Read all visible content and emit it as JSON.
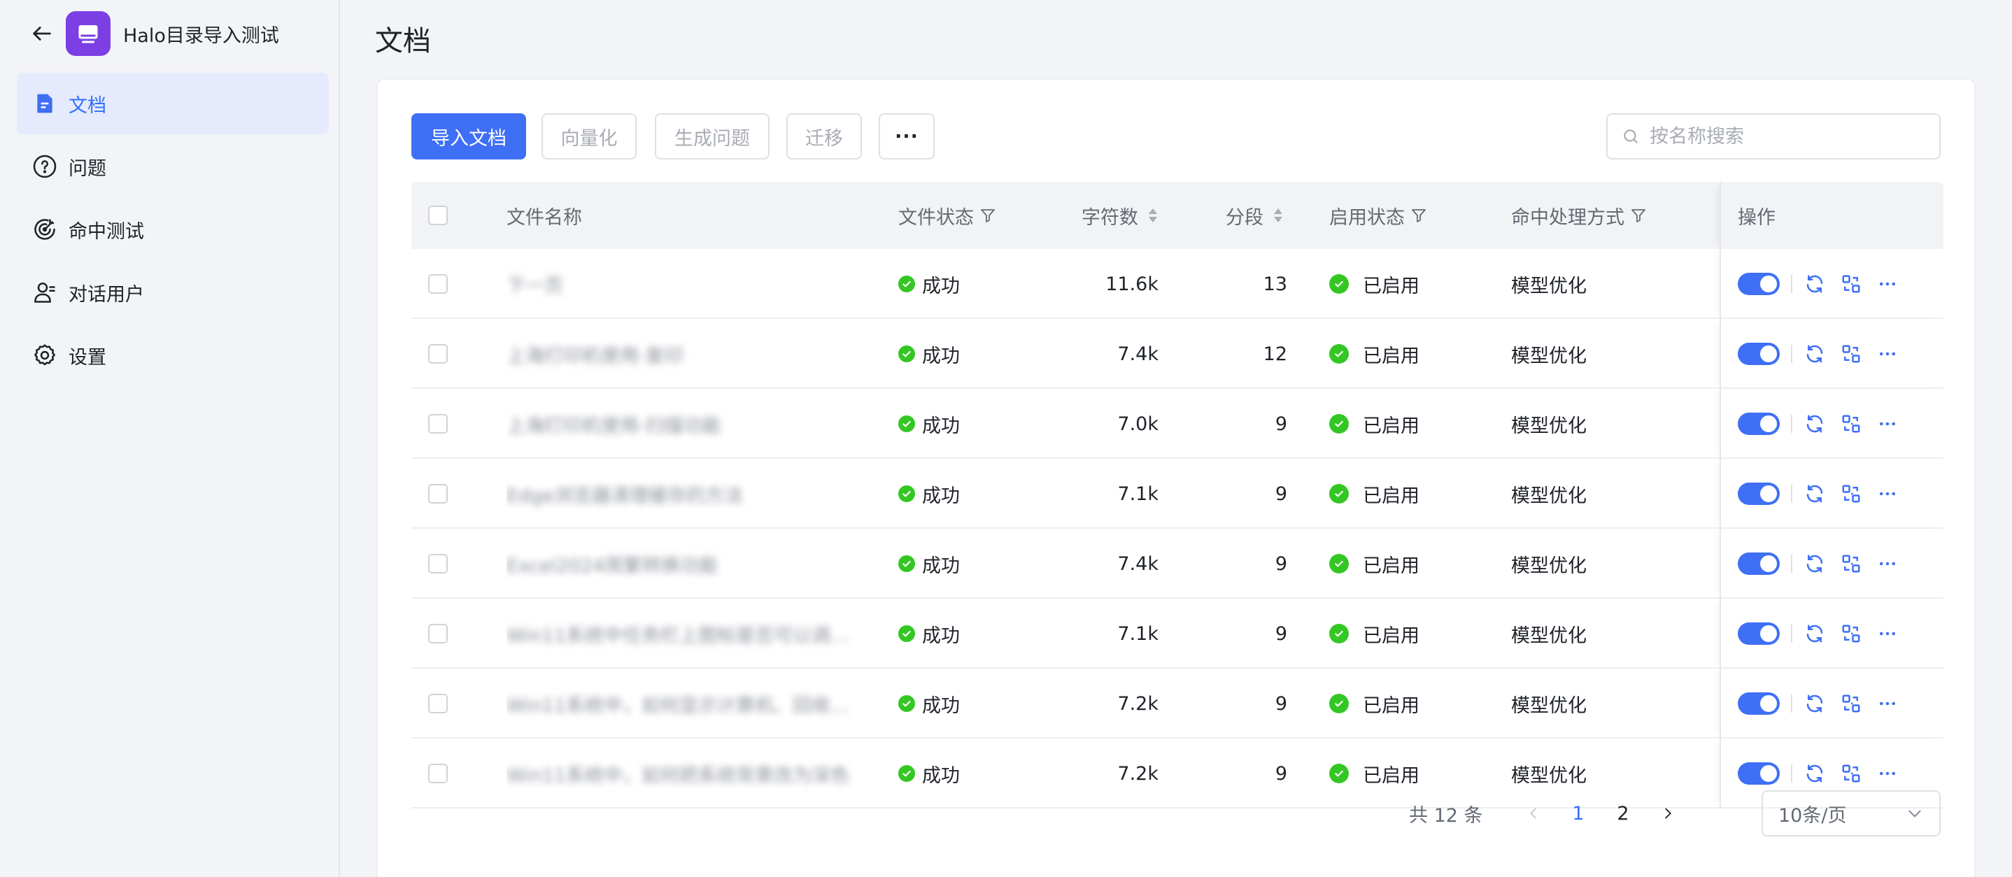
{
  "app": {
    "title": "Halo目录导入测试",
    "logo_color": "#7b3fe4"
  },
  "sidebar": {
    "items": [
      {
        "label": "文档",
        "icon": "document-icon",
        "active": true
      },
      {
        "label": "问题",
        "icon": "question-icon",
        "active": false
      },
      {
        "label": "命中测试",
        "icon": "target-icon",
        "active": false
      },
      {
        "label": "对话用户",
        "icon": "user-icon",
        "active": false
      },
      {
        "label": "设置",
        "icon": "gear-icon",
        "active": false
      }
    ]
  },
  "page": {
    "title": "文档"
  },
  "toolbar": {
    "import_label": "导入文档",
    "vectorize_label": "向量化",
    "generate_label": "生成问题",
    "migrate_label": "迁移",
    "more_label": "···",
    "search_placeholder": "按名称搜索"
  },
  "table": {
    "headers": {
      "name": "文件名称",
      "status": "文件状态",
      "chars": "字符数",
      "segments": "分段",
      "enabled": "启用状态",
      "hit_mode": "命中处理方式",
      "actions": "操作"
    },
    "rows": [
      {
        "name": "下一页",
        "status": "成功",
        "chars": "11.6k",
        "segments": "13",
        "enabled": "已启用",
        "hit_mode": "模型优化"
      },
      {
        "name": "上海打印机使用-复印",
        "status": "成功",
        "chars": "7.4k",
        "segments": "12",
        "enabled": "已启用",
        "hit_mode": "模型优化"
      },
      {
        "name": "上海打印机使用-扫描功能",
        "status": "成功",
        "chars": "7.0k",
        "segments": "9",
        "enabled": "已启用",
        "hit_mode": "模型优化"
      },
      {
        "name": "Edge浏览器清理缓存的方法",
        "status": "成功",
        "chars": "7.1k",
        "segments": "9",
        "enabled": "已启用",
        "hit_mode": "模型优化"
      },
      {
        "name": "Excel2024简繁转换功能",
        "status": "成功",
        "chars": "7.4k",
        "segments": "9",
        "enabled": "已启用",
        "hit_mode": "模型优化"
      },
      {
        "name": "Win11系统中任务栏上图标是否可以调…",
        "status": "成功",
        "chars": "7.1k",
        "segments": "9",
        "enabled": "已启用",
        "hit_mode": "模型优化"
      },
      {
        "name": "Win11系统中，如何显示计算机、回收…",
        "status": "成功",
        "chars": "7.2k",
        "segments": "9",
        "enabled": "已启用",
        "hit_mode": "模型优化"
      },
      {
        "name": "Win11系统中，如何把系统背景改为深色",
        "status": "成功",
        "chars": "7.2k",
        "segments": "9",
        "enabled": "已启用",
        "hit_mode": "模型优化"
      }
    ]
  },
  "pagination": {
    "total_label": "共 12 条",
    "pages": [
      "1",
      "2"
    ],
    "current_page": "1",
    "page_size_label": "10条/页"
  },
  "colors": {
    "accent": "#3e6ff5",
    "success": "#34c724",
    "active_nav_bg": "#e5eafc"
  }
}
